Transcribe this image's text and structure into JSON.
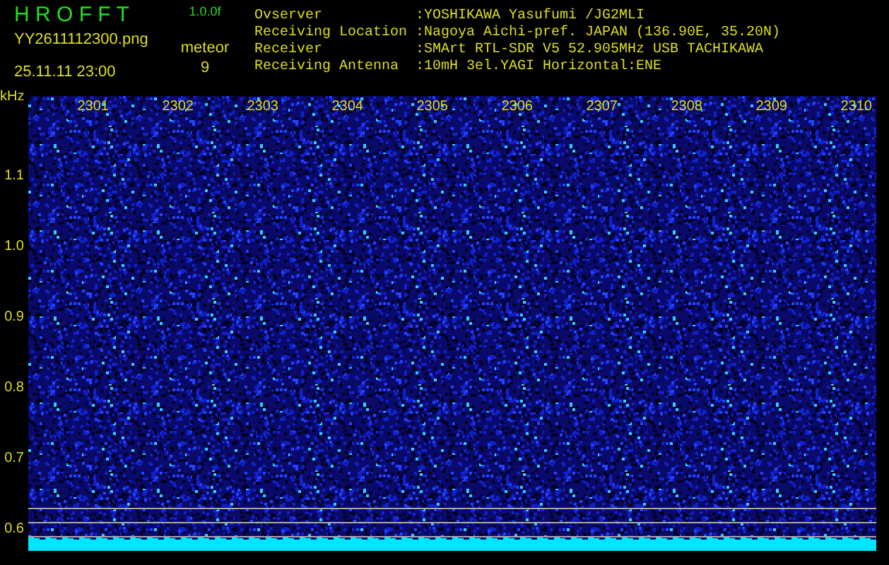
{
  "app": {
    "title": "H R O F F T",
    "version": "1.0.0f"
  },
  "file": {
    "name": "YY2611112300.png",
    "datetime": "25.11.11 23:00"
  },
  "meteor": {
    "label": "meteor",
    "count": "9"
  },
  "station_info": [
    {
      "key": "Ovserver",
      "value": ":YOSHIKAWA Yasufumi /JG2MLI"
    },
    {
      "key": "Receiving Location",
      "value": ":Nagoya Aichi-pref. JAPAN (136.90E, 35.20N)"
    },
    {
      "key": "Receiver",
      "value": ":SMArt RTL-SDR V5 52.905MHz USB TACHIKAWA"
    },
    {
      "key": "Receiving Antenna",
      "value": ":10mH 3el.YAGI Horizontal:ENE"
    }
  ],
  "spectrogram": {
    "y_unit": "kHz",
    "time_labels": [
      "2301",
      "2302",
      "2303",
      "2304",
      "2305",
      "2306",
      "2307",
      "2308",
      "2309",
      "2310"
    ],
    "freq_labels": [
      "1.1",
      "1.0",
      "0.9",
      "0.8",
      "0.7",
      "0.6"
    ]
  }
}
